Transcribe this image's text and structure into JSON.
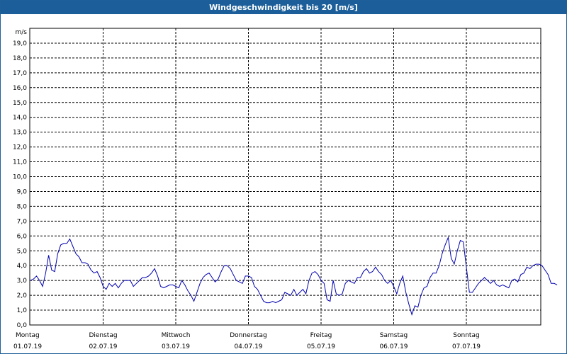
{
  "window_title": "Windgeschwindigkeit bis 20 [m/s]",
  "chart_data": {
    "type": "line",
    "title": "Windgeschwindigkeit bis 20 [m/s]",
    "ylabel": "m/s",
    "ylim": [
      0,
      20
    ],
    "grid": true,
    "y_ticks": [
      "0,0",
      "1,0",
      "2,0",
      "3,0",
      "4,0",
      "5,0",
      "6,0",
      "7,0",
      "8,0",
      "9,0",
      "10,0",
      "11,0",
      "12,0",
      "13,0",
      "14,0",
      "15,0",
      "16,0",
      "17,0",
      "18,0",
      "19,0"
    ],
    "x_ticks": [
      {
        "day": "Montag",
        "date": "01.07.19"
      },
      {
        "day": "Dienstag",
        "date": "02.07.19"
      },
      {
        "day": "Mittwoch",
        "date": "03.07.19"
      },
      {
        "day": "Donnerstag",
        "date": "04.07.19"
      },
      {
        "day": "Freitag",
        "date": "05.07.19"
      },
      {
        "day": "Samstag",
        "date": "06.07.19"
      },
      {
        "day": "Sonntag",
        "date": "07.07.19"
      }
    ],
    "series_color": "#0000b0",
    "values_per_day": 24,
    "series": [
      {
        "values": [
          3.0,
          3.1,
          3.3,
          3.0,
          2.6,
          3.5,
          4.7,
          3.7,
          3.6,
          4.8,
          5.4,
          5.5,
          5.5,
          5.8,
          5.3,
          4.8,
          4.6,
          4.2,
          4.2,
          4.1,
          3.7,
          3.5,
          3.6,
          3.2,
          2.6,
          2.4,
          2.8,
          2.6,
          2.8,
          2.5,
          2.8,
          3.0,
          3.0,
          3.0,
          2.6,
          2.8,
          3.0,
          3.2,
          3.2,
          3.3,
          3.5,
          3.8,
          3.3,
          2.6,
          2.5,
          2.6,
          2.7,
          2.7,
          2.6,
          2.5,
          3.0,
          2.7,
          2.3,
          2.0,
          1.6,
          2.2,
          2.8,
          3.2,
          3.4,
          3.5,
          3.2,
          2.9,
          3.1,
          3.6,
          4.0,
          4.0,
          3.8,
          3.4,
          3.0,
          2.9,
          2.8,
          3.3,
          3.3,
          3.2,
          2.6,
          2.4,
          2.0,
          1.6,
          1.5,
          1.5,
          1.6,
          1.5,
          1.6,
          1.7,
          2.2,
          2.1,
          2.0,
          2.4,
          2.0,
          2.2,
          2.4,
          2.1,
          3.0,
          3.5,
          3.6,
          3.4,
          3.0,
          2.8,
          1.7,
          1.6,
          3.0,
          2.1,
          2.0,
          2.1,
          2.8,
          3.0,
          2.9,
          2.8,
          3.2,
          3.2,
          3.6,
          3.8,
          3.5,
          3.6,
          3.9,
          3.6,
          3.4,
          3.0,
          2.8,
          3.0,
          2.6,
          2.1,
          2.8,
          3.3,
          2.2,
          1.4,
          0.7,
          1.3,
          1.2,
          2.0,
          2.5,
          2.6,
          3.2,
          3.5,
          3.5,
          4.0,
          4.8,
          5.4,
          5.9,
          4.5,
          4.1,
          5.0,
          5.7,
          5.6,
          3.9,
          2.2,
          2.2,
          2.5,
          2.8,
          3.0,
          3.2,
          3.0,
          2.8,
          3.0,
          2.7,
          2.6,
          2.7,
          2.6,
          2.5,
          3.0,
          3.1,
          2.9,
          3.4,
          3.5,
          3.9,
          3.8,
          4.0,
          4.1,
          4.1,
          4.0,
          3.7,
          3.4,
          2.8,
          2.8,
          2.7
        ]
      }
    ]
  }
}
